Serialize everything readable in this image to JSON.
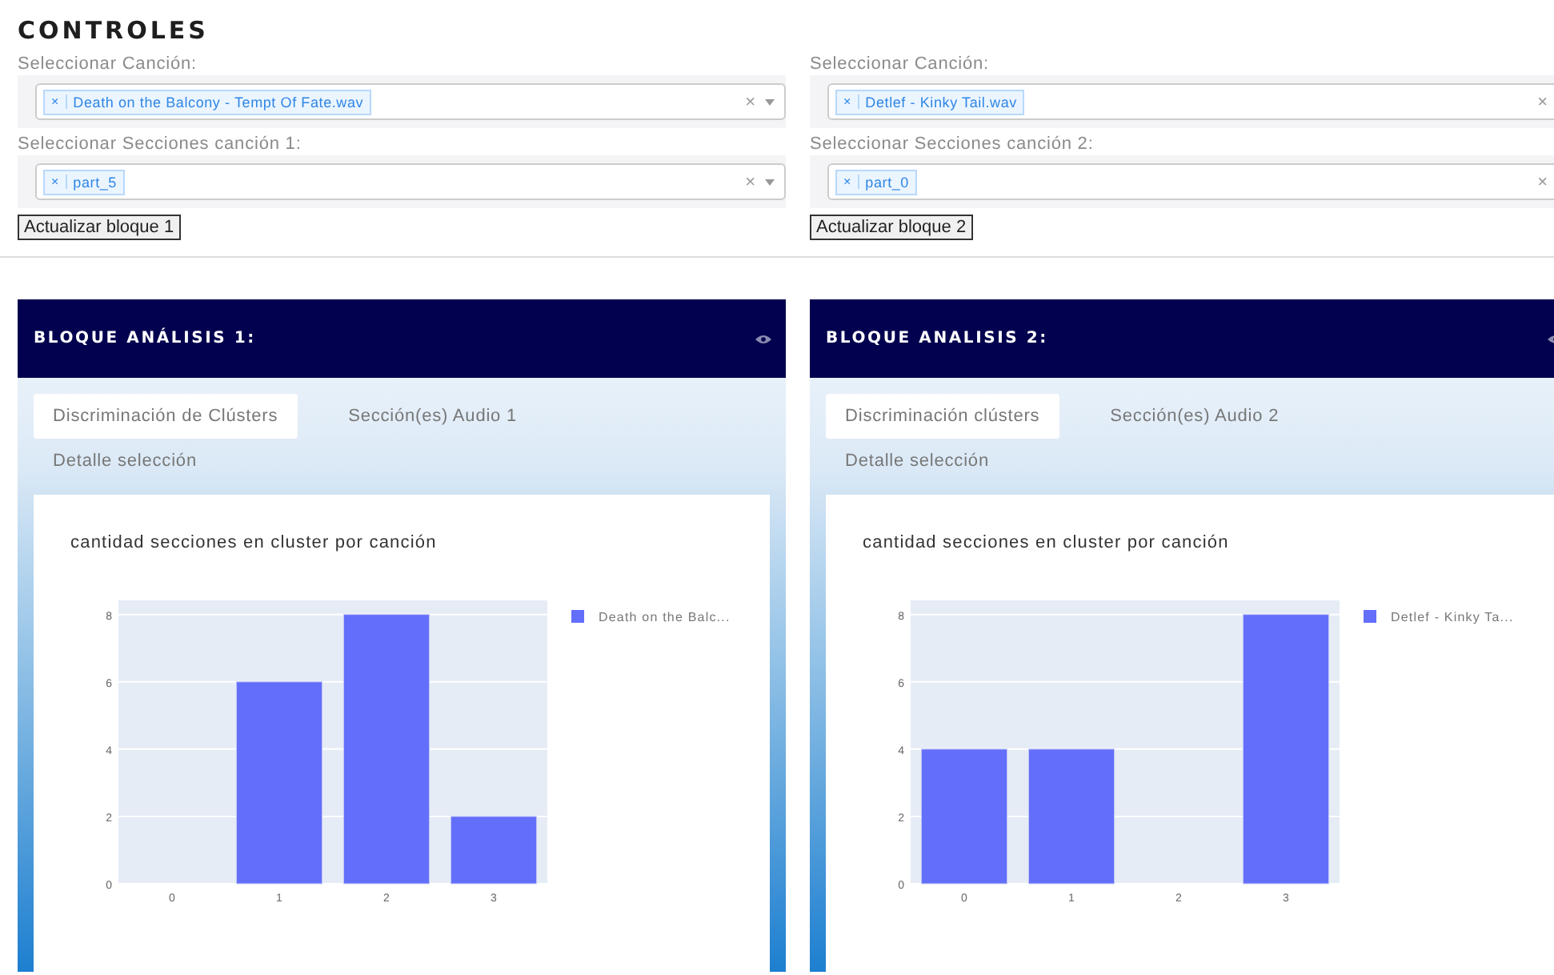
{
  "title": "CONTROLES",
  "controls": [
    {
      "song_label": "Seleccionar Canción:",
      "song_select": {
        "tags": [
          {
            "remove": "×",
            "label": "Death on the Balcony - Tempt Of Fate.wav"
          }
        ],
        "clear": "×"
      },
      "sections_label": "Seleccionar Secciones canción 1:",
      "sections_select": {
        "tags": [
          {
            "remove": "×",
            "label": "part_5"
          }
        ],
        "clear": "×"
      },
      "button": "Actualizar bloque 1"
    },
    {
      "song_label": "Seleccionar Canción:",
      "song_select": {
        "tags": [
          {
            "remove": "×",
            "label": "Detlef - Kinky Tail.wav"
          }
        ],
        "clear": "×"
      },
      "sections_label": "Seleccionar Secciones canción 2:",
      "sections_select": {
        "tags": [
          {
            "remove": "×",
            "label": "part_0"
          }
        ],
        "clear": "×"
      },
      "button": "Actualizar bloque 2"
    }
  ],
  "blocks": [
    {
      "title": "BLOQUE ANÁLISIS 1:",
      "tabs": [
        {
          "label": "Discriminación de Clústers",
          "selected": true
        },
        {
          "label": "Sección(es) Audio 1",
          "selected": false
        },
        {
          "label": "Detalle selección",
          "selected": false
        }
      ],
      "chart_title": "cantidad secciones en cluster por canción",
      "chart_data": {
        "type": "bar",
        "grid": true,
        "categories": [
          "0",
          "1",
          "2",
          "3"
        ],
        "ylim": [
          0,
          8.42
        ],
        "yticks": [
          0,
          2,
          4,
          6,
          8
        ],
        "series": [
          {
            "name": "Death on the Balc...",
            "color": "#636efa",
            "values": [
              0,
              6,
              8,
              2
            ]
          }
        ]
      }
    },
    {
      "title": "BLOQUE ANALISIS 2:",
      "tabs": [
        {
          "label": "Discriminación clústers",
          "selected": true
        },
        {
          "label": "Sección(es) Audio 2",
          "selected": false
        },
        {
          "label": "Detalle selección",
          "selected": false
        }
      ],
      "chart_title": "cantidad secciones en cluster por canción",
      "chart_data": {
        "type": "bar",
        "grid": true,
        "categories": [
          "0",
          "1",
          "2",
          "3"
        ],
        "ylim": [
          0,
          8.42
        ],
        "yticks": [
          0,
          2,
          4,
          6,
          8
        ],
        "series": [
          {
            "name": "Detlef - Kinky Ta...",
            "color": "#636efa",
            "values": [
              4,
              4,
              0,
              8
            ]
          }
        ]
      }
    }
  ]
}
